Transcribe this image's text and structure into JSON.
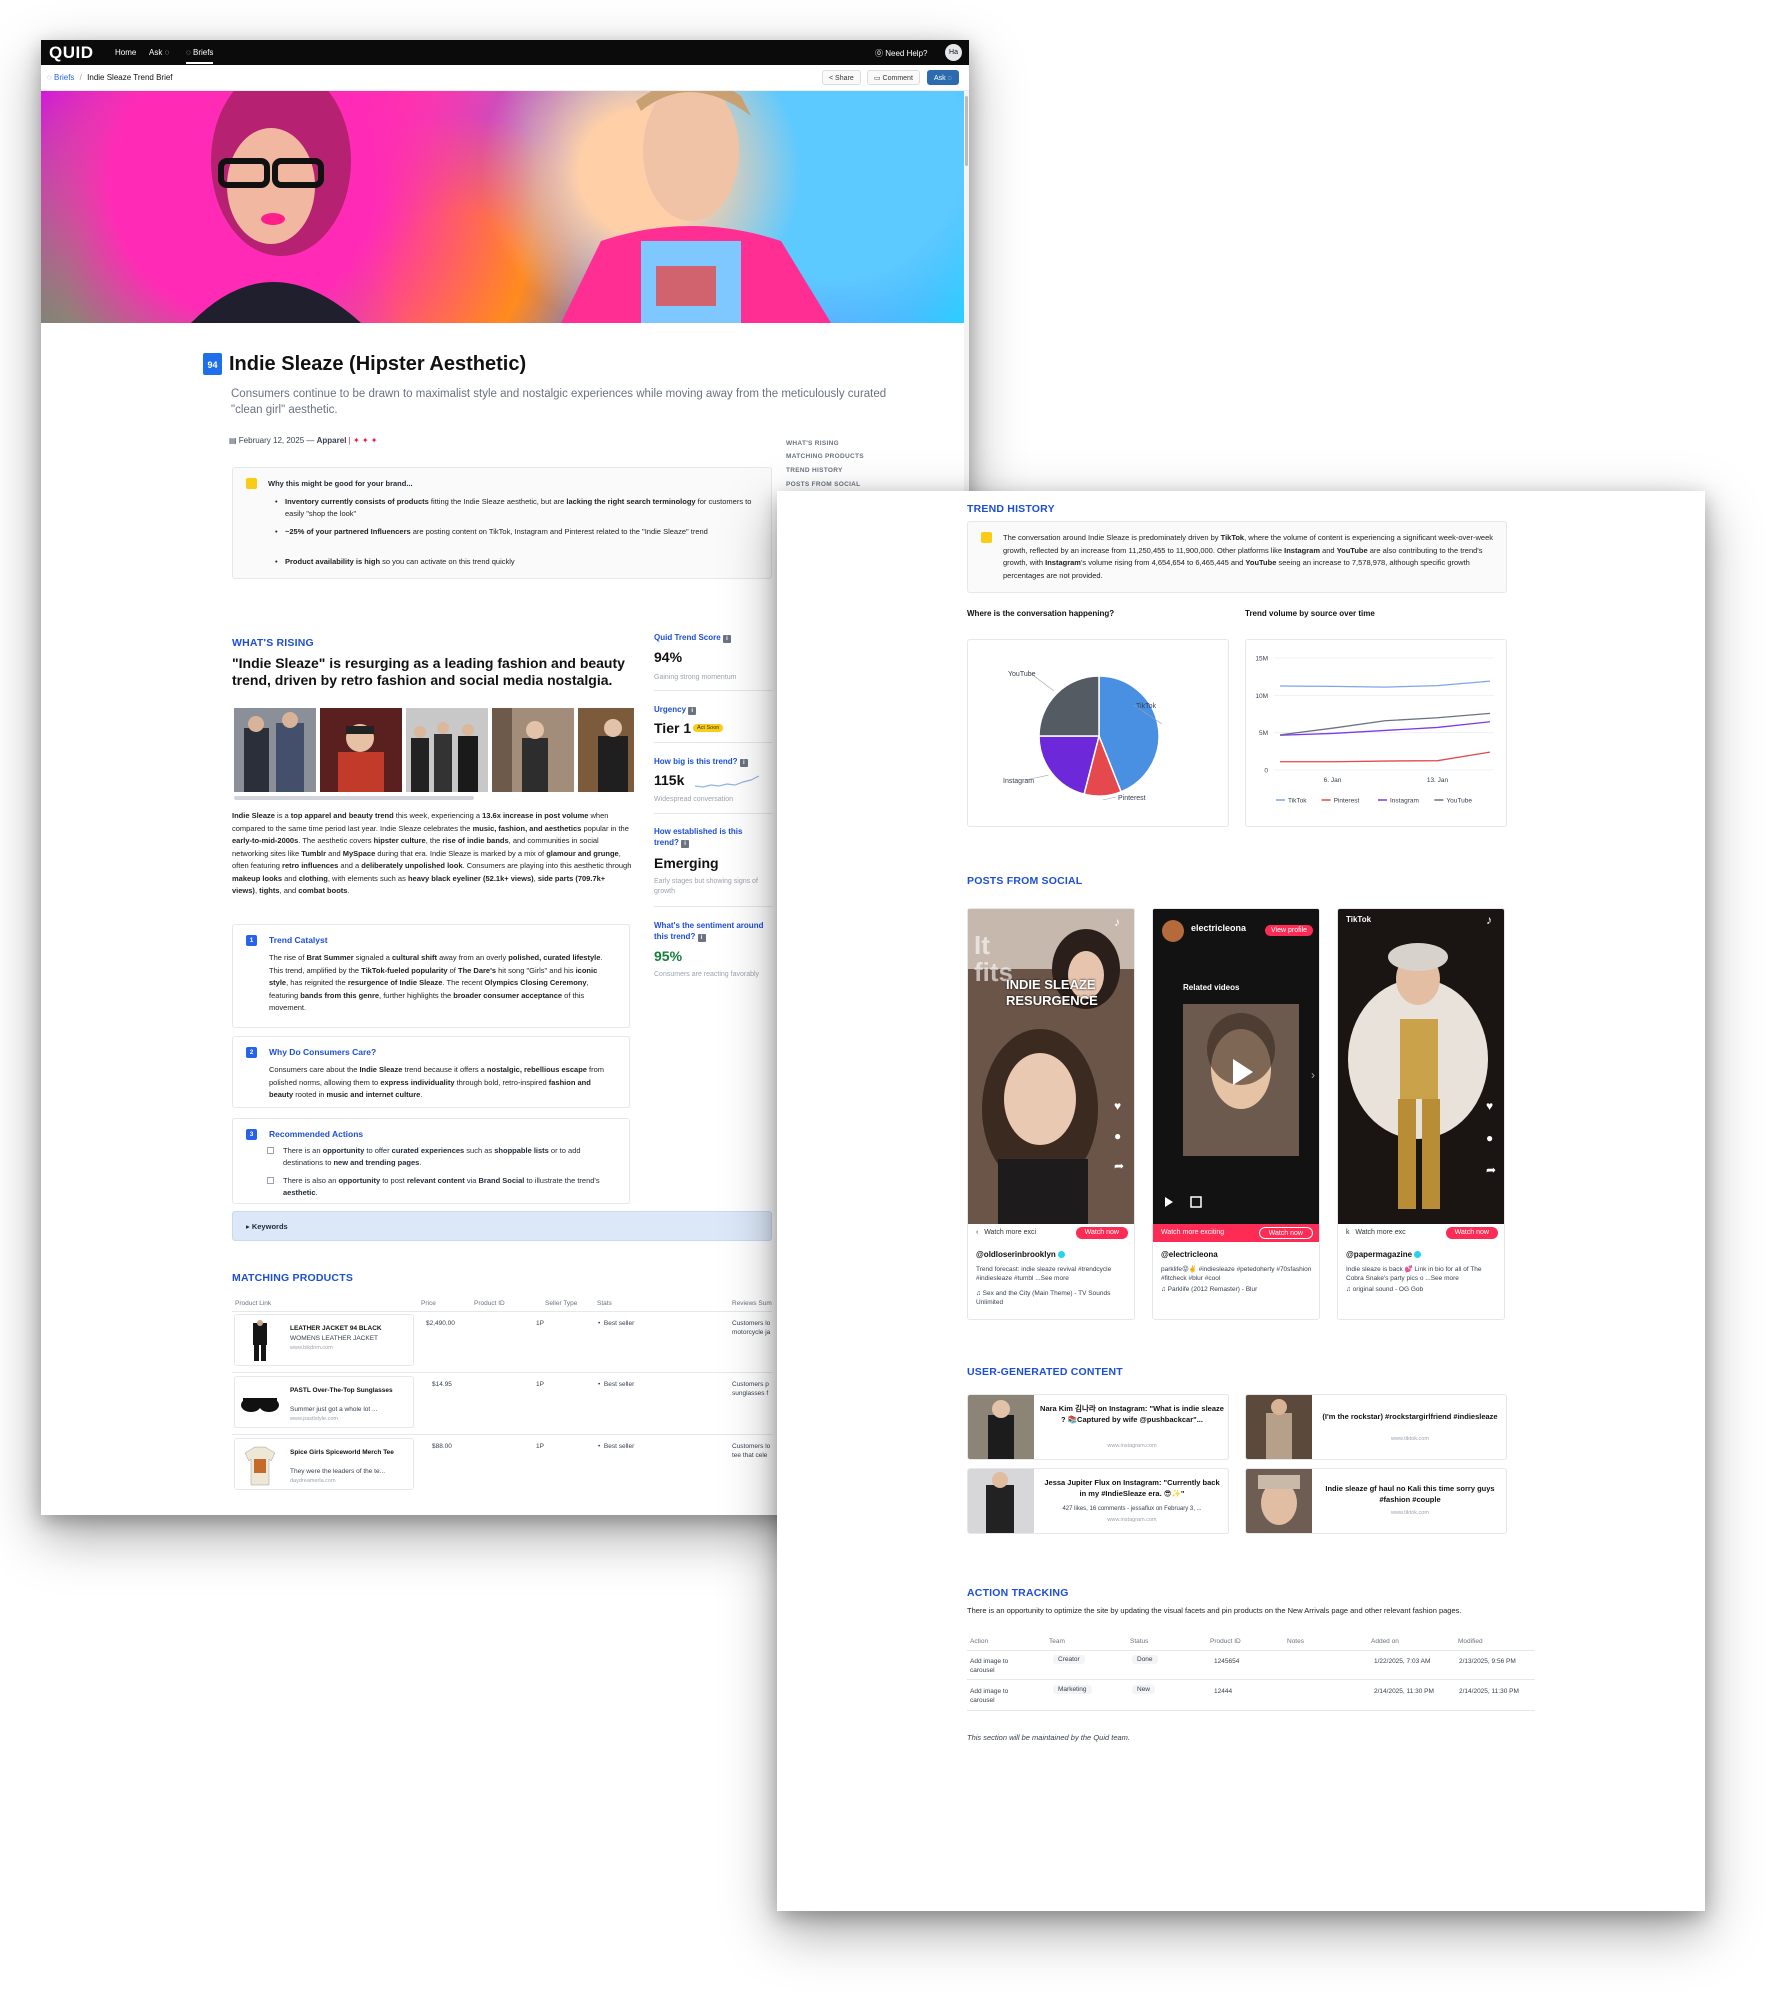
{
  "nav": {
    "logo": "QUID",
    "links": [
      "Home",
      "Ask ◌",
      "◌ Briefs"
    ],
    "help": "⓪ Need Help?",
    "avatar": "Ha"
  },
  "breadcrumb": {
    "root": "◌ Briefs",
    "sep": "/",
    "current": "Indie Sleaze Trend Brief"
  },
  "toolbar": {
    "share": "< Share",
    "comment": "▭ Comment",
    "ask": "Ask ◌"
  },
  "brief": {
    "badge_top": "QUID",
    "badge_num": "94",
    "title": "Indie Sleaze (Hipster Aesthetic)",
    "lede": "Consumers continue to be drawn to maximalist style and nostalgic experiences while moving away from the meticulously curated \"clean girl\" aesthetic.",
    "date": "▤ February 12, 2025 —",
    "category": "Apparel",
    "flags": "| ✦ ✦ ✦"
  },
  "toc": [
    "WHAT'S RISING",
    "MATCHING PRODUCTS",
    "TREND HISTORY",
    "POSTS FROM SOCIAL"
  ],
  "good_for_brand": {
    "title": "Why this might be good for your brand...",
    "b1_strong": "Inventory currently consists of products",
    "b1_mid": " fitting the Indie Sleaze aesthetic, but are ",
    "b1_strong2": "lacking the right search terminology",
    "b1_end": " for customers to easily \"shop the look\"",
    "b2_strong": "~25% of your partnered Influencers",
    "b2_end": " are posting content on TikTok, Instagram and Pinterest related to the \"Indie Sleaze\" trend",
    "b3_strong": "Product availability is high",
    "b3_end": " so you can activate on this trend quickly"
  },
  "rising": {
    "section": "WHAT'S RISING",
    "headline": "\"Indie Sleaze\" is resurging as a leading fashion and beauty trend, driven by retro fashion and social media nostalgia.",
    "p1": "Indie Sleaze",
    "p2": " is a ",
    "p3": "top apparel and beauty trend",
    "p4": " this week, experiencing a ",
    "p5": "13.6x increase in post volume",
    "p6": " when compared to the same time period last year. Indie Sleaze celebrates the ",
    "p7": "music, fashion, and aesthetics",
    "p8": " popular in the ",
    "p9": "early-to-mid-2000s",
    "p10": ". The aesthetic covers ",
    "p11": "hipster culture",
    "p12": ", the ",
    "p13": "rise of indie bands",
    "p14": ", and communities in social networking sites like ",
    "p15": "Tumblr",
    "p16": " and ",
    "p17": "MySpace",
    "p18": " during that era. Indie Sleaze is marked by a mix of ",
    "p19": "glamour and grunge",
    "p20": ", often featuring ",
    "p21": "retro influences",
    "p22": " and a ",
    "p23": "deliberately unpolished look",
    "p24": ". Consumers are playing into this aesthetic through ",
    "p25": "makeup looks",
    "p26": " and ",
    "p27": "clothing",
    "p28": ", with elements such as ",
    "p29": "heavy black eyeliner (52.1k+ views)",
    "p30": ", ",
    "p31": "side parts (709.7k+ views)",
    "p32": ", ",
    "p33": "tights",
    "p34": ", and ",
    "p35": "combat boots",
    "p36": "."
  },
  "cards": {
    "catalyst": {
      "num": "1",
      "title": "Trend Catalyst",
      "a": "The rise of ",
      "b": "Brat Summer",
      "c": " signaled a ",
      "d": "cultural shift",
      "e": " away from an overly ",
      "f": "polished, curated lifestyle",
      "g": ". This trend, amplified by the ",
      "h": "TikTok-fueled popularity",
      "i": " of ",
      "j": "The Dare's",
      "k": " hit song \"Girls\" and his ",
      "l": "iconic style",
      "m": ", has reignited the ",
      "n": "resurgence of Indie Sleaze",
      "o": ". The recent ",
      "p": "Olympics Closing Ceremony",
      "q": ", featuring ",
      "r": "bands from this genre",
      "s": ", further highlights the ",
      "t": "broader consumer acceptance",
      "u": " of this movement."
    },
    "why": {
      "num": "2",
      "title": "Why Do Consumers Care?",
      "a": "Consumers care about the ",
      "b": "Indie Sleaze",
      "c": " trend because it offers a ",
      "d": "nostalgic, rebellious escape",
      "e": " from polished norms, allowing them to ",
      "f": "express individuality",
      "g": " through bold, retro-inspired ",
      "h": "fashion and beauty",
      "i": " rooted in ",
      "j": "music and internet culture",
      "k": "."
    },
    "actions": {
      "num": "3",
      "title": "Recommended Actions",
      "r1a": "There is an ",
      "r1b": "opportunity",
      "r1c": " to offer ",
      "r1d": "curated experiences",
      "r1e": " such as ",
      "r1f": "shoppable lists",
      "r1g": " or to add destinations to ",
      "r1h": "new and trending pages",
      "r1i": ".",
      "r2a": "There is also an ",
      "r2b": "opportunity",
      "r2c": " to post ",
      "r2d": "relevant content",
      "r2e": " via ",
      "r2f": "Brand Social",
      "r2g": " to illustrate the trend's ",
      "r2h": "aesthetic",
      "r2i": "."
    }
  },
  "metrics": {
    "score_h": "Quid Trend Score",
    "score_v": "94%",
    "score_s": "Gaining strong momentum",
    "urgency_h": "Urgency",
    "urgency_v": "Tier 1",
    "urgency_pill": "Act Soon",
    "size_h": "How big is this trend?",
    "size_v": "115k",
    "size_s": "Widespread conversation",
    "est_h": "How established is this trend?",
    "est_v": "Emerging",
    "est_s": "Early stages but showing signs of growth",
    "sent_h": "What's the sentiment around this trend?",
    "sent_v": "95%",
    "sent_s": "Consumers are reacting favorably",
    "sent_color": "#15803d",
    "info": "i"
  },
  "keywords": {
    "label": "▸  Keywords"
  },
  "products": {
    "section": "MATCHING PRODUCTS",
    "headers": [
      "Product Link",
      "Price",
      "Product ID",
      "Seller Type",
      "Stats",
      "Reviews Sum"
    ],
    "rows": [
      {
        "name": "LEATHER JACKET 94 BLACK",
        "desc": "WOMENS LEATHER JACKET",
        "site": "www.bikdnm.com",
        "price": "$2,490.00",
        "seller": "1P",
        "stat": "Best seller",
        "review": "Customers lo motorcycle ja"
      },
      {
        "name": "PASTL Over-The-Top Sunglasses",
        "desc": "Summer just got a whole lot ...",
        "site": "www.pastlstyle.com",
        "price": "$14.95",
        "seller": "1P",
        "stat": "Best seller",
        "review": "Customers p sunglasses f"
      },
      {
        "name": "Spice Girls Spiceworld Merch Tee",
        "desc": "They were the leaders of the te...",
        "site": "daydreamerla.com",
        "price": "$88.00",
        "seller": "1P",
        "stat": "Best seller",
        "review": "Customers lo tee that cele"
      }
    ]
  },
  "history": {
    "section": "TREND HISTORY",
    "t1": "The conversation around Indie Sleaze is predominately driven by ",
    "t2": "TikTok",
    "t3": ", where the volume of content is experiencing a significant week-over-week growth, reflected by an increase from 11,250,455 to 11,900,000. Other platforms like ",
    "t4": "Instagram",
    "t5": " and ",
    "t6": "YouTube",
    "t7": " are also contributing to the trend's growth, with ",
    "t8": "Instagram",
    "t9": "'s volume rising from 4,654,654 to 6,465,445 and ",
    "t10": "YouTube",
    "t11": " seeing an increase to 7,578,978, although specific growth percentages are not provided.",
    "pie_title": "Where is the conversation happening?",
    "line_title": "Trend volume by source over time"
  },
  "chart_data": [
    {
      "type": "pie",
      "title": "Where is the conversation happening?",
      "categories": [
        "TikTok",
        "Pinterest",
        "Instagram",
        "YouTube"
      ],
      "values": [
        44,
        10,
        21,
        25
      ],
      "colors": [
        "#4a90e2",
        "#e5484d",
        "#6d28d9",
        "#555b63"
      ]
    },
    {
      "type": "line",
      "title": "Trend volume by source over time",
      "x": [
        "",
        "6. Jan",
        "",
        "13. Jan",
        ""
      ],
      "yticks": [
        "0",
        "5M",
        "10M",
        "15M"
      ],
      "ylim": [
        0,
        15000000
      ],
      "series": [
        {
          "name": "TikTok",
          "color": "#7aa7e8",
          "values": [
            11250455,
            11200000,
            11100000,
            11300000,
            11900000
          ]
        },
        {
          "name": "Pinterest",
          "color": "#e5484d",
          "values": [
            1100000,
            1100000,
            1200000,
            1250000,
            2400000
          ]
        },
        {
          "name": "Instagram",
          "color": "#7c3aed",
          "values": [
            4654654,
            4900000,
            5300000,
            5700000,
            6465445
          ]
        },
        {
          "name": "YouTube",
          "color": "#6b7280",
          "values": [
            4700000,
            5600000,
            6600000,
            7000000,
            7578978
          ]
        }
      ]
    }
  ],
  "social": {
    "section": "POSTS FROM SOCIAL",
    "posts": [
      {
        "overlay": "INDIE SLEAZE RESURGENCE",
        "watch": "Watch more exci",
        "btn": "Watch now",
        "handle": "@oldloserinbrooklyn",
        "caption": "Trend forecast: indie sleaze revival #trendcycle #indiesleaze #tumbl ...See more",
        "music": "♫  Sex and the City (Main Theme) - TV Sounds Unlimited"
      },
      {
        "overlay": "Related videos",
        "user": "electricleona",
        "view": "View profile",
        "watch": "Watch more exciting",
        "btn": "Watch now",
        "handle": "@electricleona",
        "caption": "parklife😝✌️ #indiesleaze #petedoherty #70sfashion #fitcheck #blur #cool",
        "music": "♫  Parklife (2012 Remaster) - Blur"
      },
      {
        "overlay": "TikTok",
        "watch": "Watch more exc",
        "btn": "Watch now",
        "handle": "@papermagazine",
        "caption": "Indie sleaze is back 💕 Link in bio for all of The Cobra Snake's party pics o ...See more",
        "music": "♫  original sound - OG Gob"
      }
    ]
  },
  "ugc": {
    "section": "USER-GENERATED CONTENT",
    "items": [
      {
        "title": "Nara Kim 김나라 on Instagram: \"What is indie sleaze ? 📚Captured by wife @pushbackcar\"...",
        "sub": "",
        "site": "www.instagram.com"
      },
      {
        "title": "(I'm the rockstar) #rockstargirlfriend #indiesleaze",
        "sub": "",
        "site": "www.tiktok.com"
      },
      {
        "title": "Jessa Jupiter Flux on Instagram: \"Currently back in my #IndieSleaze era. 😎✨\"",
        "sub": "427 likes, 16 comments - jessaflux on February 3, ...",
        "site": "www.instagram.com"
      },
      {
        "title": "Indie sleaze gf haul no Kali this time sorry guys #fashion #couple",
        "sub": "",
        "site": "www.tiktok.com"
      }
    ]
  },
  "tracking": {
    "section": "ACTION TRACKING",
    "intro": "There is an opportunity to optimize the site by updating the visual facets and pin products on the New Arrivals page and other relevant fashion pages.",
    "headers": [
      "Action",
      "Team",
      "Status",
      "Product ID",
      "Notes",
      "Added on",
      "Modified"
    ],
    "rows": [
      {
        "action": "Add image to carousel",
        "team": "Creator",
        "status": "Done",
        "pid": "1245654",
        "notes": "",
        "added": "1/22/2025, 7:03 AM",
        "modified": "2/13/2025, 9:56 PM"
      },
      {
        "action": "Add image to carousel",
        "team": "Marketing",
        "status": "New",
        "pid": "12444",
        "notes": "",
        "added": "2/14/2025, 11:30 PM",
        "modified": "2/14/2025, 11:30 PM"
      }
    ],
    "footer": "This section will be maintained by the Quid team."
  }
}
